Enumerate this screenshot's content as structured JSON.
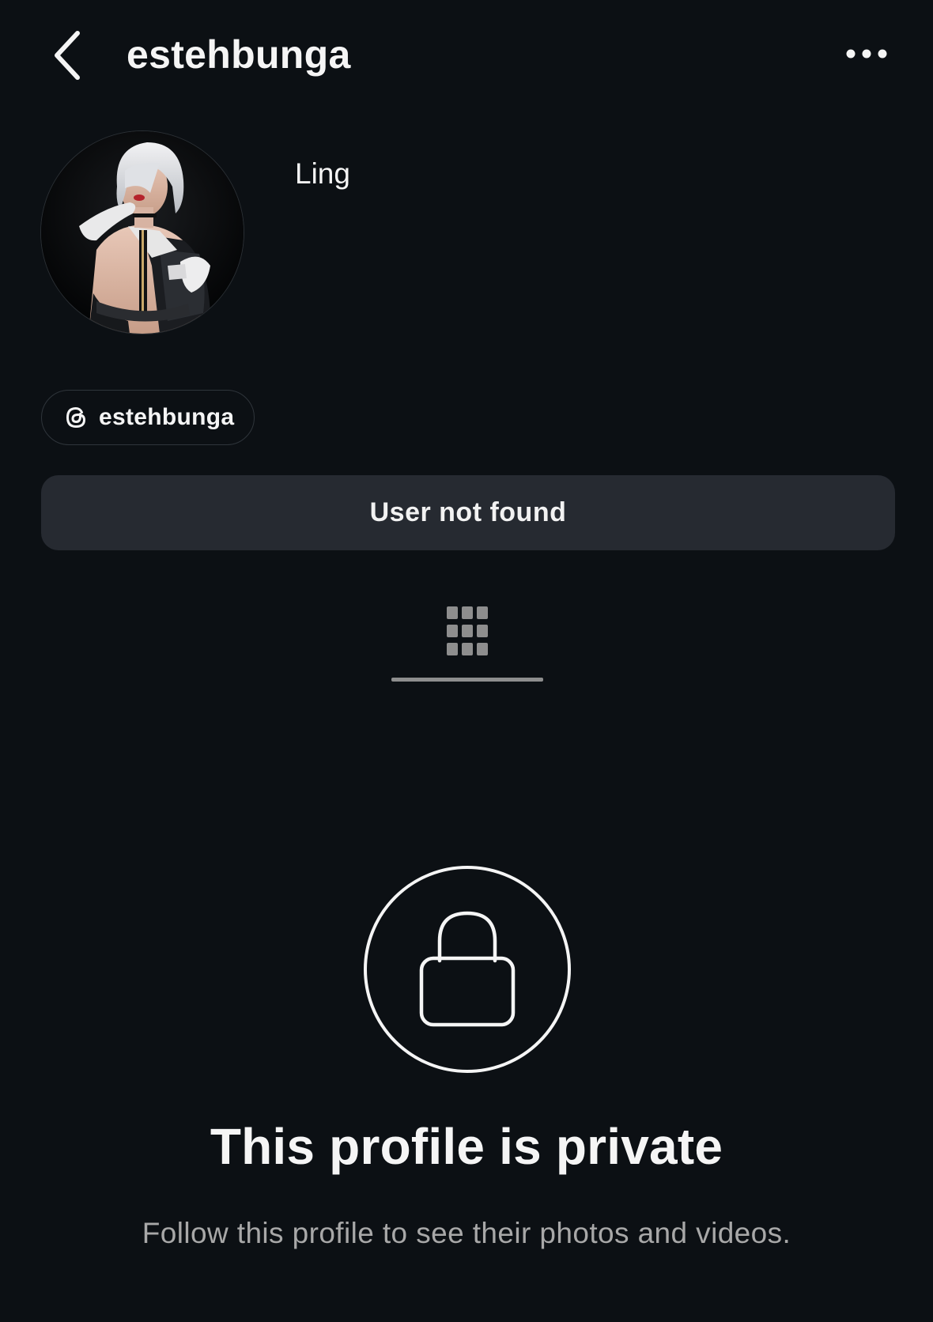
{
  "header": {
    "username": "estehbunga",
    "back_icon": "chevron-left-icon",
    "more_icon": "ellipsis-horizontal-icon"
  },
  "profile": {
    "display_name": "Ling",
    "avatar": "profile-photo",
    "threads_handle": "estehbunga",
    "threads_icon": "threads-icon"
  },
  "status": {
    "message": "User not found"
  },
  "tabs": {
    "active": "grid",
    "grid_icon": "grid-icon"
  },
  "private_notice": {
    "icon": "lock-icon",
    "title": "This profile is private",
    "subtitle": "Follow this profile to see their photos and videos."
  },
  "colors": {
    "background": "#0c1014",
    "status_bar": "#262a31",
    "secondary_text": "#a8a8a8",
    "primary_text": "#f5f5f5"
  }
}
